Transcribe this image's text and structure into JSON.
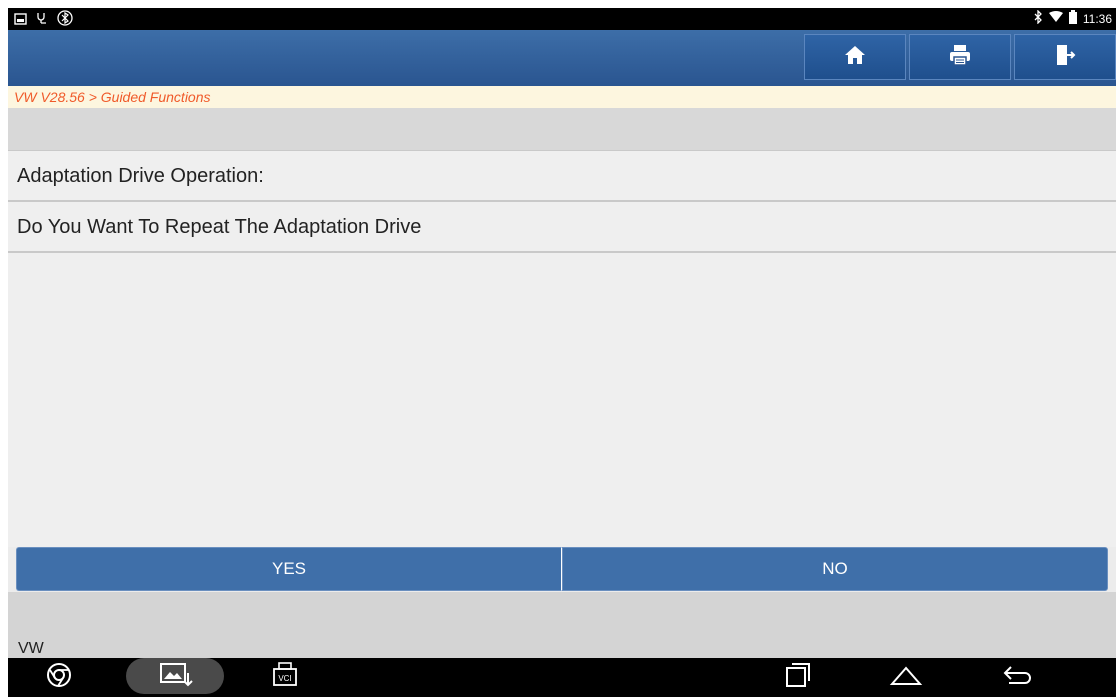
{
  "statusbar": {
    "time": "11:36"
  },
  "header": {
    "buttons": [
      {
        "icon": "home-icon"
      },
      {
        "icon": "print-icon"
      },
      {
        "icon": "exit-icon"
      }
    ]
  },
  "breadcrumb": "VW V28.56 > Guided Functions",
  "content": {
    "rows": [
      "Adaptation Drive Operation:",
      "Do You Want To Repeat The Adaptation Drive"
    ]
  },
  "actions": {
    "yes": "YES",
    "no": "NO"
  },
  "footer": {
    "brand": "VW"
  },
  "navbar": {
    "vci_label": "VCI"
  },
  "colors": {
    "accent": "#3f6fa9",
    "breadcrumb_text": "#f05a2a",
    "header": "#2f5f9c"
  }
}
